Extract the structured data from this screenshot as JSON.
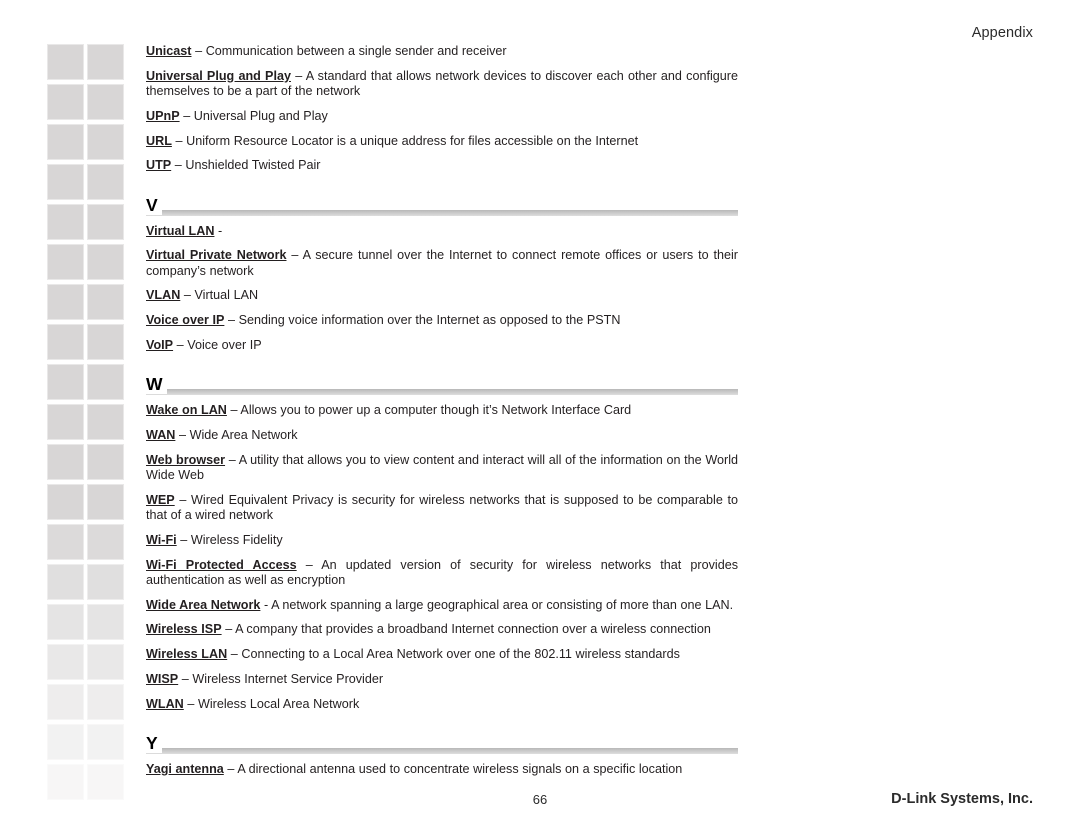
{
  "header": {
    "right_label": "Appendix"
  },
  "footer": {
    "page_number": "66",
    "company": "D-Link Systems, Inc."
  },
  "thumbnails": {
    "rows": 19,
    "columns": 2,
    "color": "#d8d6d6"
  },
  "glossary": {
    "continued_entries": [
      {
        "term": "Unicast",
        "separator": " – ",
        "definition": "Communication between a single sender and receiver"
      },
      {
        "term": "Universal Plug and Play",
        "separator": " – ",
        "definition": "A standard that allows network devices to discover each other and configure themselves to be a part of the network"
      },
      {
        "term": "UPnP",
        "separator": " – ",
        "definition": "Universal Plug and Play"
      },
      {
        "term": "URL",
        "separator": " – ",
        "definition": "Uniform Resource Locator is a unique address for files accessible on the Internet"
      },
      {
        "term": "UTP",
        "separator": " – ",
        "definition": "Unshielded Twisted Pair"
      }
    ],
    "sections": [
      {
        "letter": "V",
        "entries": [
          {
            "term": "Virtual LAN",
            "separator": " -",
            "definition": ""
          },
          {
            "term": "Virtual Private Network",
            "separator": " – ",
            "definition": "A secure tunnel over the Internet to connect remote offices or users to their company’s network"
          },
          {
            "term": "VLAN",
            "separator": " – ",
            "definition": "Virtual LAN"
          },
          {
            "term": "Voice over IP",
            "separator": " – ",
            "definition": "Sending voice information over the Internet as opposed to the PSTN"
          },
          {
            "term": "VoIP",
            "separator": " – ",
            "definition": "Voice over IP"
          }
        ]
      },
      {
        "letter": "W",
        "entries": [
          {
            "term": "Wake on LAN",
            "separator": " – ",
            "definition": "Allows you to power up a computer though it’s Network Interface Card"
          },
          {
            "term": "WAN",
            "separator": " – ",
            "definition": "Wide Area Network"
          },
          {
            "term": "Web browser",
            "separator": " – ",
            "definition": "A utility that allows you to view content and interact will all of the information on the World Wide Web"
          },
          {
            "term": "WEP",
            "separator": " – ",
            "definition": "Wired Equivalent Privacy is security for wireless networks that is supposed  to be comparable to that of a wired network"
          },
          {
            "term": "Wi-Fi",
            "separator": " – ",
            "definition": "Wireless Fidelity"
          },
          {
            "term": "Wi-Fi Protected Access",
            "separator": " – ",
            "definition": "An updated version of security for wireless networks that provides authentication as well as encryption"
          },
          {
            "term": "Wide Area Network",
            "separator": " - ",
            "definition": "A network spanning a large geographical area or consisting of more than one LAN."
          },
          {
            "term": "Wireless ISP",
            "separator": " – ",
            "definition": "A company that provides a broadband Internet connection over a wireless connection"
          },
          {
            "term": "Wireless LAN",
            "separator": " – ",
            "definition": "Connecting to a Local Area Network over one of the 802.11 wireless standards"
          },
          {
            "term": "WISP",
            "separator": " – ",
            "definition": "Wireless Internet Service Provider"
          },
          {
            "term": "WLAN",
            "separator": " – ",
            "definition": "Wireless Local Area Network"
          }
        ]
      },
      {
        "letter": "Y",
        "entries": [
          {
            "term": "Yagi antenna",
            "separator": " – ",
            "definition": "A directional antenna used to concentrate wireless signals on a specific location"
          }
        ]
      }
    ]
  }
}
